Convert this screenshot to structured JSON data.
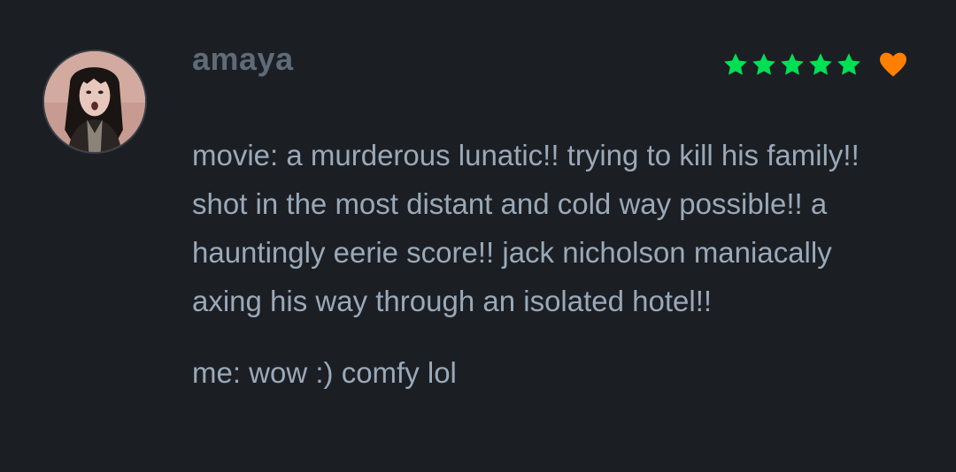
{
  "review": {
    "username": "amaya",
    "rating_stars": 5,
    "liked": true,
    "colors": {
      "star": "#00e054",
      "heart": "#ff8000",
      "text": "#9aa9b8",
      "username": "#5e6b78",
      "background": "#1b1e23"
    },
    "icons": [
      "avatar-photo",
      "star-icon",
      "heart-icon"
    ],
    "paragraphs": [
      "movie: a murderous lunatic!! trying to kill his family!! shot in the most distant and cold way possible!! a hauntingly eerie score!! jack nicholson maniacally axing his way through an isolated hotel!!",
      "me: wow :) comfy lol"
    ]
  }
}
